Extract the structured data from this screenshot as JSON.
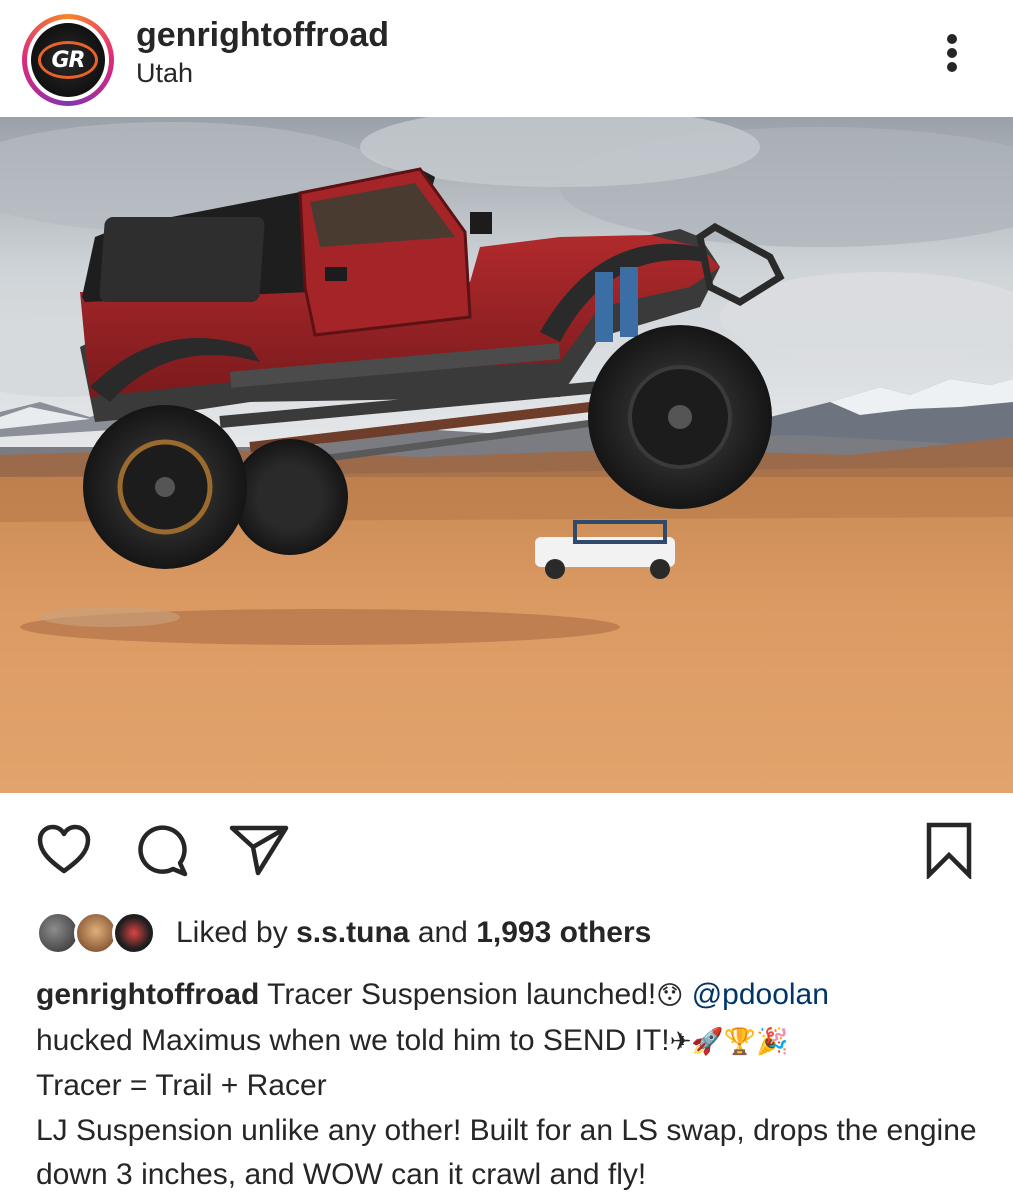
{
  "post": {
    "username": "genrightoffroad",
    "location": "Utah",
    "avatar_text": "GR"
  },
  "icons": {
    "more": "more-vertical-icon",
    "like": "heart-icon",
    "comment": "comment-icon",
    "share": "paper-plane-icon",
    "save": "bookmark-icon"
  },
  "likes": {
    "prefix": "Liked by",
    "user": "s.s.tuna",
    "middle": "and",
    "count": "1,993 others"
  },
  "caption": {
    "username": "genrightoffroad",
    "line1_text": "Tracer Suspension launched!",
    "emoji_surprised": "😯",
    "mention": "@pdoolan",
    "line2_text": "hucked Maximus when we told him to SEND IT!",
    "emoji_plane": "✈",
    "emoji_rocket": "🚀",
    "emoji_trophy": "🏆",
    "emoji_party": "🎉",
    "line3": "Tracer = Trail + Racer",
    "line4": "LJ Suspension unlike any other! Built for an LS swap, drops the engine down 3 inches, and WOW can it crawl and fly!"
  },
  "colors": {
    "text": "#262626",
    "mention": "#003569",
    "jeep_body": "#9b2226",
    "sand": "#d9955c"
  }
}
